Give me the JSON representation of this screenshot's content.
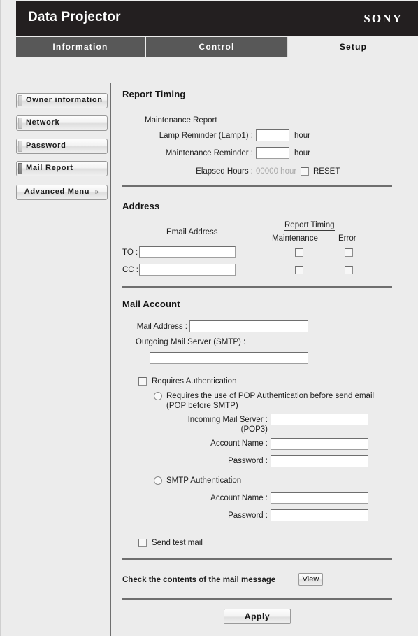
{
  "header": {
    "title": "Data Projector",
    "brand": "SONY"
  },
  "tabs": [
    {
      "label": "Information",
      "active": false
    },
    {
      "label": "Control",
      "active": false
    },
    {
      "label": "Setup",
      "active": true
    }
  ],
  "sidebar": {
    "items": [
      {
        "label": "Owner information",
        "selected": false
      },
      {
        "label": "Network",
        "selected": false
      },
      {
        "label": "Password",
        "selected": false
      },
      {
        "label": "Mail Report",
        "selected": true
      },
      {
        "label": "Advanced Menu",
        "selected": false,
        "chevron": "chevron-double-down-icon",
        "chevron_glyph": "»"
      }
    ]
  },
  "report_timing": {
    "title": "Report Timing",
    "maintenance_report_label": "Maintenance Report",
    "lamp_reminder_label": "Lamp Reminder (Lamp1) :",
    "lamp_reminder_value": "",
    "lamp_reminder_unit": "hour",
    "maintenance_reminder_label": "Maintenance Reminder :",
    "maintenance_reminder_value": "",
    "maintenance_reminder_unit": "hour",
    "elapsed_hours_label": "Elapsed Hours :",
    "elapsed_hours_value": "00000 hour",
    "reset_label": "RESET",
    "reset_checked": false
  },
  "address": {
    "title": "Address",
    "email_address_header": "Email Address",
    "report_timing_header": "Report Timing",
    "maintenance_header": "Maintenance",
    "error_header": "Error",
    "rows": [
      {
        "label": "TO :",
        "value": "",
        "maintenance_checked": false,
        "error_checked": false
      },
      {
        "label": "CC :",
        "value": "",
        "maintenance_checked": false,
        "error_checked": false
      }
    ]
  },
  "mail_account": {
    "title": "Mail Account",
    "mail_address_label": "Mail Address :",
    "mail_address_value": "",
    "smtp_label": "Outgoing Mail Server (SMTP) :",
    "smtp_value": "",
    "requires_auth_label": "Requires Authentication",
    "requires_auth_checked": false,
    "pop_radio_label_line1": "Requires the use of POP Authentication before send email",
    "pop_radio_label_line2": "(POP before SMTP)",
    "pop_radio_selected": false,
    "incoming_label_line1": "Incoming Mail Server :",
    "incoming_label_line2": "(POP3)",
    "incoming_value": "",
    "pop_account_label": "Account Name :",
    "pop_account_value": "",
    "pop_password_label": "Password :",
    "pop_password_value": "",
    "smtp_auth_label": "SMTP Authentication",
    "smtp_auth_selected": false,
    "smtp_account_label": "Account Name :",
    "smtp_account_value": "",
    "smtp_password_label": "Password :",
    "smtp_password_value": "",
    "send_test_mail_label": "Send test mail",
    "send_test_mail_checked": false
  },
  "footer": {
    "check_contents_label": "Check the contents of the mail message",
    "view_button": "View",
    "apply_button": "Apply"
  },
  "colors": {
    "header_bg": "#231f20",
    "tab_inactive_bg": "#585858",
    "page_bg": "#ececec",
    "rule": "#6e6e6e"
  }
}
